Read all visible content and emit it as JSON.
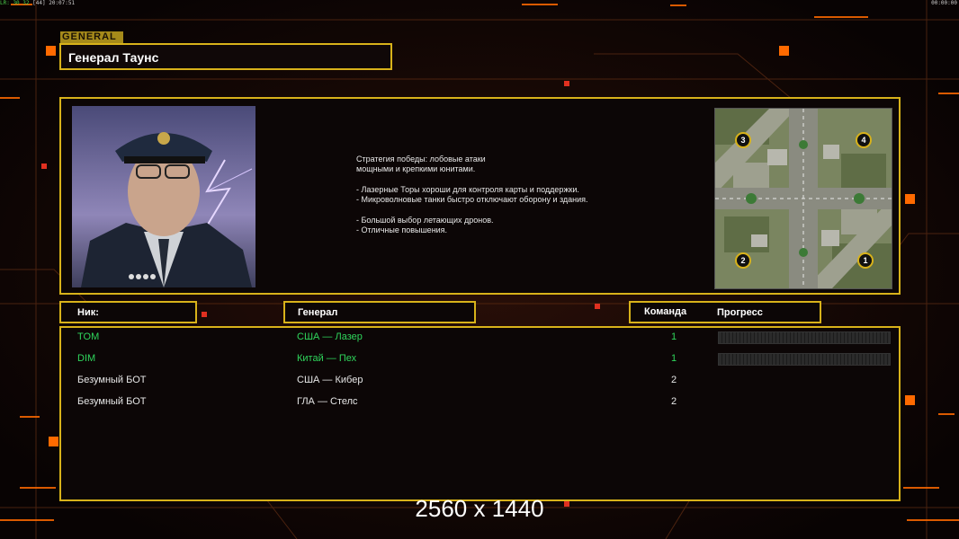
{
  "hud": {
    "stats_label": "LR: 30 32",
    "stats_extra": "[44]",
    "clock_left": "20:07:51",
    "clock_right": "00:00:00"
  },
  "general_tag": "GENERAL",
  "general_name": "Генерал Таунс",
  "description": [
    "Стратегия победы: лобовые атаки",
    "мощными и крепкими юнитами.",
    "",
    "- Лазерные Торы хороши для контроля карты и поддержки.",
    "- Микроволновые танки быстро отключают оборону и здания.",
    "",
    "- Большой выбор летающих дронов.",
    "- Отличные повышения."
  ],
  "headers": {
    "nick": "Ник:",
    "general": "Генерал",
    "team": "Команда",
    "progress": "Прогресс"
  },
  "players": [
    {
      "nick": "TOM",
      "general": "США — Лазер",
      "team": "1",
      "color": "green",
      "progress": 0,
      "has_progress": true
    },
    {
      "nick": "DIM",
      "general": "Китай — Пех",
      "team": "1",
      "color": "green",
      "progress": 0,
      "has_progress": true
    },
    {
      "nick": "Безумный БОТ",
      "general": "США — Кибер",
      "team": "2",
      "color": "white",
      "has_progress": false
    },
    {
      "nick": "Безумный БОТ",
      "general": "ГЛА — Стелс",
      "team": "2",
      "color": "white",
      "has_progress": false
    }
  ],
  "map_start_positions": [
    "1",
    "2",
    "3",
    "4"
  ],
  "resolution_label": "2560 x 1440",
  "colors": {
    "accent": "#d8b21a",
    "orange": "#ff6a00",
    "player_green": "#2fd65c"
  }
}
